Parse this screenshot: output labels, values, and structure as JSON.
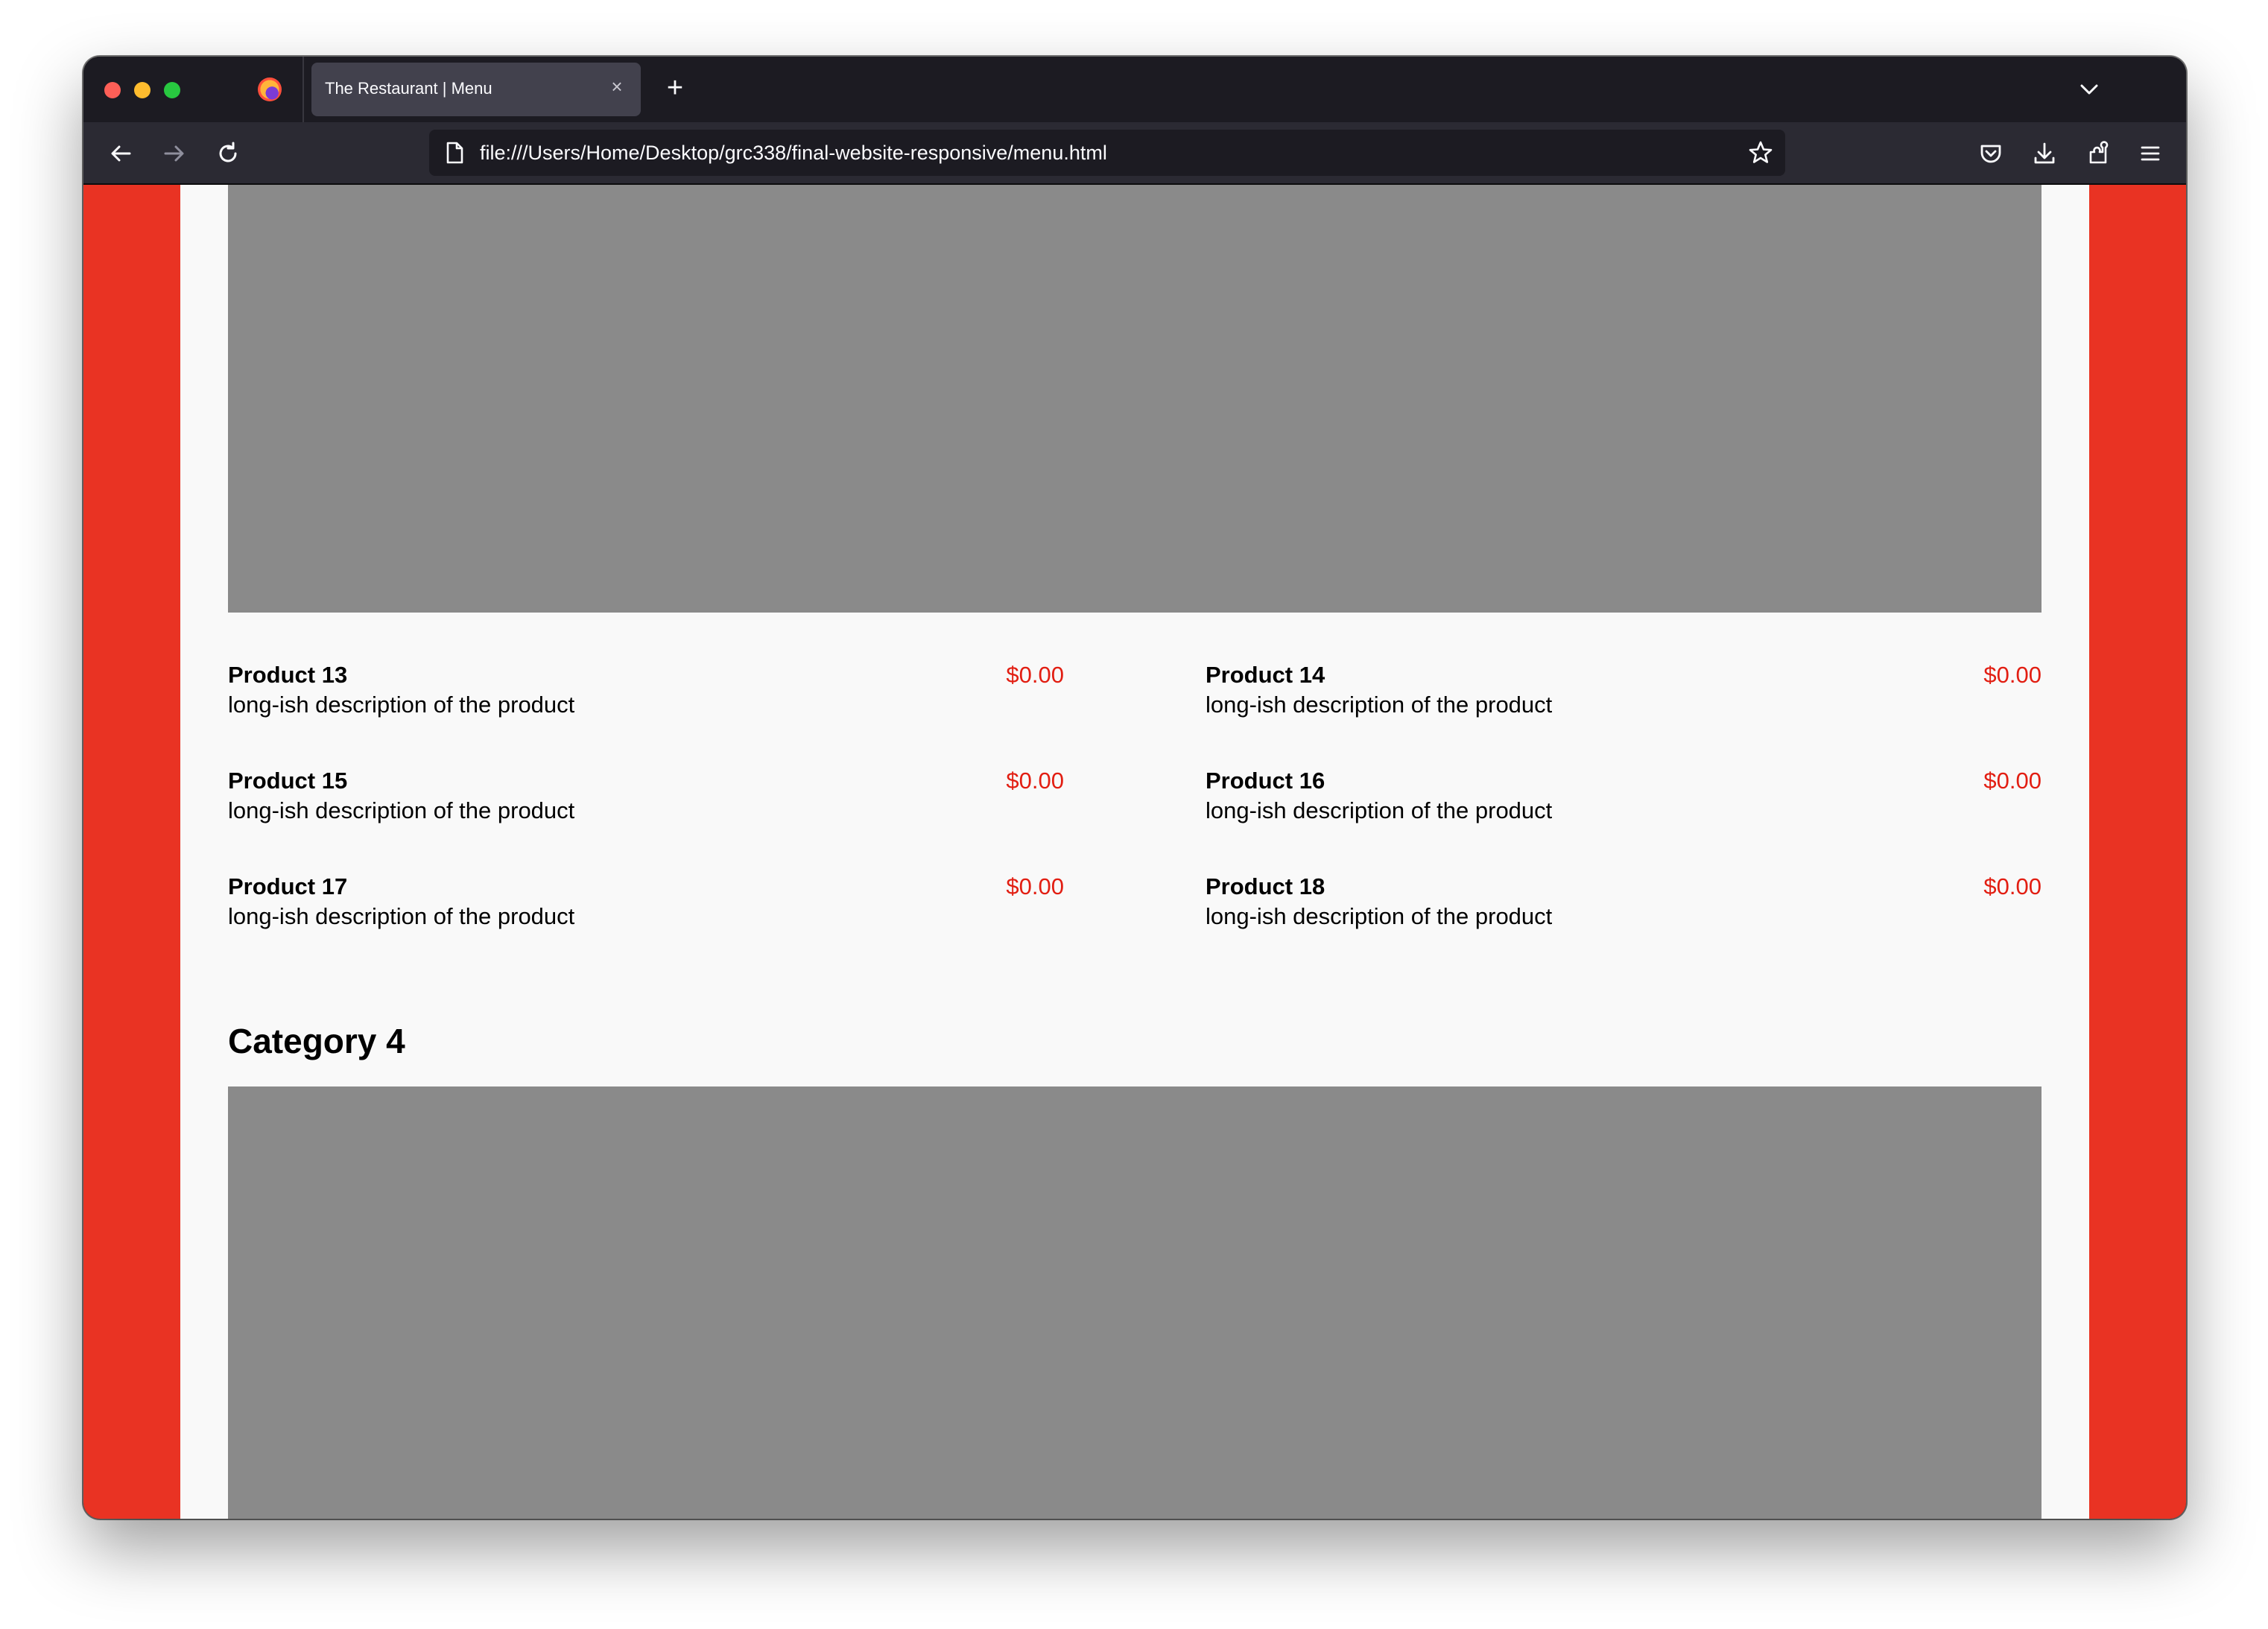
{
  "browser": {
    "tab_title": "The Restaurant | Menu",
    "url": "file:///Users/Home/Desktop/grc338/final-website-responsive/menu.html"
  },
  "colors": {
    "accent_red": "#e93323",
    "price_red": "#e21e12",
    "placeholder_gray": "#8a8a8a",
    "page_bg": "#f9f9f9"
  },
  "menu": {
    "products": [
      {
        "name": "Product 13",
        "description": "long-ish description of the product",
        "price": "$0.00"
      },
      {
        "name": "Product 14",
        "description": "long-ish description of the product",
        "price": "$0.00"
      },
      {
        "name": "Product 15",
        "description": "long-ish description of the product",
        "price": "$0.00"
      },
      {
        "name": "Product 16",
        "description": "long-ish description of the product",
        "price": "$0.00"
      },
      {
        "name": "Product 17",
        "description": "long-ish description of the product",
        "price": "$0.00"
      },
      {
        "name": "Product 18",
        "description": "long-ish description of the product",
        "price": "$0.00"
      }
    ],
    "next_category": "Category 4"
  }
}
